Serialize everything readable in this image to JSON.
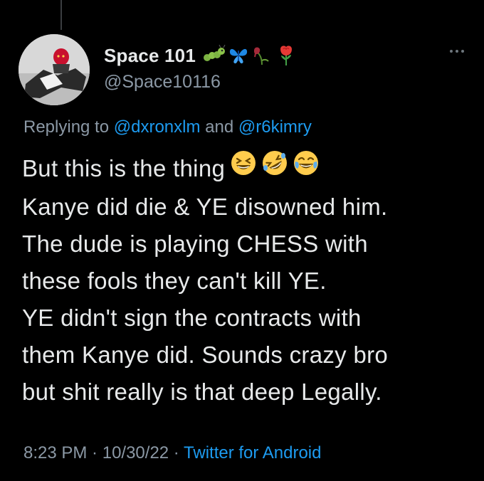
{
  "tweet": {
    "author": {
      "display_name": "Space 101",
      "handle": "@Space10116",
      "avatar_icon": "profile-photo",
      "name_emojis": [
        "caterpillar-emoji",
        "butterfly-emoji",
        "wilted-flower-emoji",
        "rose-emoji"
      ]
    },
    "reply": {
      "prefix": "Replying to ",
      "mention1": "@dxronxlm",
      "conjunction": " and ",
      "mention2": "@r6kimry"
    },
    "text_lines": [
      "But this is the thing",
      "Kanye did die & YE disowned him.",
      "The dude is playing CHESS with",
      "these fools they can't kill YE.",
      "YE didn't sign the contracts with",
      "them Kanye did. Sounds crazy bro",
      "but shit really is that deep Legally."
    ],
    "text_emojis": [
      "grinning-squinting-face",
      "rolling-on-floor-laughing",
      "face-with-tears-of-joy"
    ],
    "meta": {
      "time": "8:23 PM",
      "separator1": " · ",
      "date": "10/30/22",
      "separator2": " · ",
      "source": "Twitter for Android"
    }
  },
  "colors": {
    "background": "#000000",
    "text_primary": "#e7e9ea",
    "text_secondary": "#8b98a5",
    "link": "#1d9bf0"
  }
}
